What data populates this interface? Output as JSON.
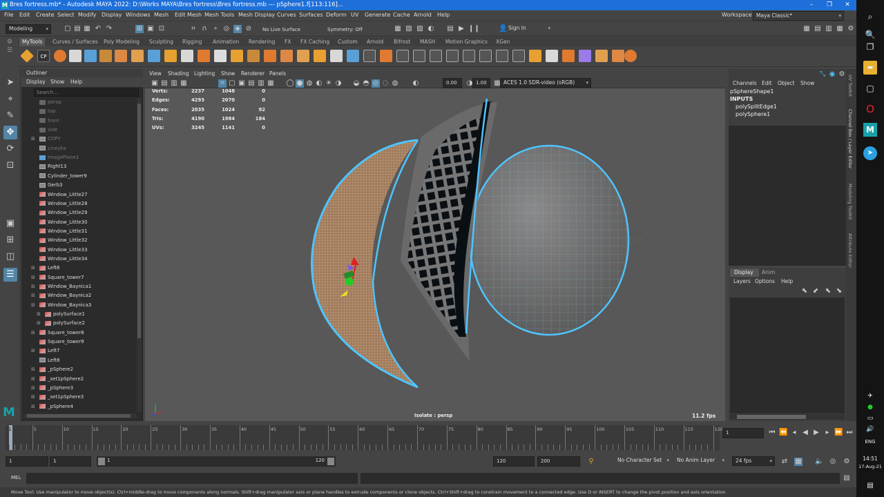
{
  "titlebar": {
    "logo": "M",
    "title": "Bres fortress.mb* - Autodesk MAYA 2022: D:\\Works MAYA\\Bres fortress\\Bres fortress.mb   ---   pSphere1.f[113:116]..."
  },
  "menubar": {
    "items": [
      "File",
      "Edit",
      "Create",
      "Select",
      "Modify",
      "Display",
      "Windows",
      "Mesh",
      "Edit Mesh",
      "Mesh Tools",
      "Mesh Display",
      "Curves",
      "Surfaces",
      "Deform",
      "UV",
      "Generate",
      "Cache",
      "Arnold",
      "Help"
    ],
    "workspace_label": "Workspace :",
    "workspace_value": "Maya Classic*"
  },
  "statusline": {
    "mode": "Modeling",
    "live_surface": "No Live Surface",
    "symmetry": "Symmetry: Off",
    "sign_in": "Sign In"
  },
  "shelf": {
    "tabs": [
      "MyTools",
      "Curves / Surfaces",
      "Poly Modeling",
      "Sculpting",
      "Rigging",
      "Animation",
      "Rendering",
      "FX",
      "FX Caching",
      "Custom",
      "Arnold",
      "Bifrost",
      "MASH",
      "Motion Graphics",
      "XGen"
    ],
    "active_tab": "MyTools",
    "cp_label": "CP",
    "colors": [
      "#e8a030",
      "#5aa0d8",
      "#d8d8d8",
      "#c88a3a",
      "#e07a30",
      "#dd8844",
      "#e0a050"
    ]
  },
  "outliner": {
    "title": "Outliner",
    "menu": [
      "Display",
      "Show",
      "Help"
    ],
    "search_placeholder": "Search...",
    "items": [
      {
        "label": "persp",
        "dim": true,
        "icon": "camera-icon"
      },
      {
        "label": "top",
        "dim": true,
        "icon": "camera-icon"
      },
      {
        "label": "front",
        "dim": true,
        "icon": "camera-icon"
      },
      {
        "label": "side",
        "dim": true,
        "icon": "camera-icon"
      },
      {
        "label": "COPY",
        "dim": true,
        "icon": "group-icon",
        "plus": true
      },
      {
        "label": "Lineyka",
        "dim": true,
        "icon": "group-icon"
      },
      {
        "label": "imagePlane1",
        "dim": true,
        "icon": "image-plane-icon"
      },
      {
        "label": "Right13",
        "icon": "group-icon"
      },
      {
        "label": "Cylinder_tower9",
        "icon": "group-icon"
      },
      {
        "label": "Gerb3",
        "icon": "group-icon"
      },
      {
        "label": "Window_Little27",
        "icon": "mesh-icon"
      },
      {
        "label": "Window_Little28",
        "icon": "mesh-icon"
      },
      {
        "label": "Window_Little29",
        "icon": "mesh-icon"
      },
      {
        "label": "Window_Little30",
        "icon": "mesh-icon"
      },
      {
        "label": "Window_Little31",
        "icon": "mesh-icon"
      },
      {
        "label": "Window_Little32",
        "icon": "mesh-icon"
      },
      {
        "label": "Window_Little33",
        "icon": "mesh-icon"
      },
      {
        "label": "Window_Little34",
        "icon": "mesh-icon"
      },
      {
        "label": "Left6",
        "icon": "mesh-icon",
        "plus": true
      },
      {
        "label": "Square_tower7",
        "icon": "mesh-icon",
        "plus": true
      },
      {
        "label": "Window_Baynica1",
        "icon": "mesh-icon",
        "plus": true
      },
      {
        "label": "Window_Baynica2",
        "icon": "mesh-icon",
        "plus": true
      },
      {
        "label": "Window_Baynica3",
        "icon": "mesh-icon",
        "plus": true
      },
      {
        "label": "polySurface1",
        "icon": "mesh-icon",
        "plus": true,
        "indent": 1
      },
      {
        "label": "polySurface2",
        "icon": "mesh-icon",
        "plus": true,
        "indent": 1
      },
      {
        "label": "Square_tower8",
        "icon": "mesh-icon",
        "plus": true
      },
      {
        "label": "Square_tower9",
        "icon": "mesh-icon"
      },
      {
        "label": "Left7",
        "icon": "mesh-icon",
        "plus": true
      },
      {
        "label": "Left8",
        "icon": "group-icon"
      },
      {
        "label": "_pSphere2",
        "icon": "mesh-icon",
        "plus": true
      },
      {
        "label": "_set1pSphere2",
        "icon": "mesh-icon",
        "plus": true
      },
      {
        "label": "_pSphere3",
        "icon": "mesh-icon",
        "plus": true
      },
      {
        "label": "_set1pSphere3",
        "icon": "mesh-icon",
        "plus": true
      },
      {
        "label": "_pSphere4",
        "icon": "mesh-icon",
        "plus": true
      }
    ]
  },
  "viewport": {
    "menu": [
      "View",
      "Shading",
      "Lighting",
      "Show",
      "Renderer",
      "Panels"
    ],
    "field_a": "0.00",
    "field_b": "1.00",
    "color_space": "ACES 1.0 SDR-video (sRGB)",
    "hud_rows": [
      {
        "label": "Verts:",
        "v1": "2237",
        "v2": "1048",
        "v3": "0"
      },
      {
        "label": "Edges:",
        "v1": "4293",
        "v2": "2070",
        "v3": "0"
      },
      {
        "label": "Faces:",
        "v1": "2035",
        "v2": "1024",
        "v3": "92"
      },
      {
        "label": "Tris:",
        "v1": "4190",
        "v2": "1984",
        "v3": "184"
      },
      {
        "label": "UVs:",
        "v1": "3245",
        "v2": "1141",
        "v3": "0"
      }
    ],
    "camera_label": "Isolate : persp",
    "fps": "11.2 fps"
  },
  "channels": {
    "menu": [
      "Channels",
      "Edit",
      "Object",
      "Show"
    ],
    "shape": "pSphereShape1",
    "inputs_label": "INPUTS",
    "inputs": [
      "polySplitEdge1",
      "polySphere1"
    ]
  },
  "layers": {
    "tabs": [
      "Display",
      "Anim"
    ],
    "menu": [
      "Layers",
      "Options",
      "Help"
    ]
  },
  "sidetabs": [
    "UV Toolkit",
    "Channel Box / Layer Editor",
    "Modeling Toolkit",
    "Attribute Editor"
  ],
  "timeslider": {
    "ticks": [
      "5",
      "10",
      "15",
      "20",
      "25",
      "30",
      "35",
      "40",
      "45",
      "50",
      "55",
      "60",
      "65",
      "70",
      "75",
      "80",
      "85",
      "90",
      "95",
      "100",
      "105",
      "110",
      "115",
      "120"
    ],
    "current_frame_marker": "1",
    "current_frame": "1"
  },
  "range": {
    "start": "1",
    "playback_start": "1",
    "slider_start": "1",
    "slider_end": "120",
    "playback_end": "120",
    "end": "200",
    "character_set": "No Character Set",
    "anim_layer": "No Anim Layer",
    "fps": "24 fps"
  },
  "cmdline": {
    "label": "MEL"
  },
  "help_text": "Move Tool: Use manipulator to move object(s). Ctrl+middle-drag to move components along normals. Shift+drag manipulator axis or plane handles to extrude components or clone objects. Ctrl+Shift+drag to constrain movement to a connected edge. Use D or INSERT to change the pivot position and axis orientation.",
  "taskbar": {
    "lang": "ENG",
    "time": "14:51",
    "date": "17-Aug-21"
  }
}
